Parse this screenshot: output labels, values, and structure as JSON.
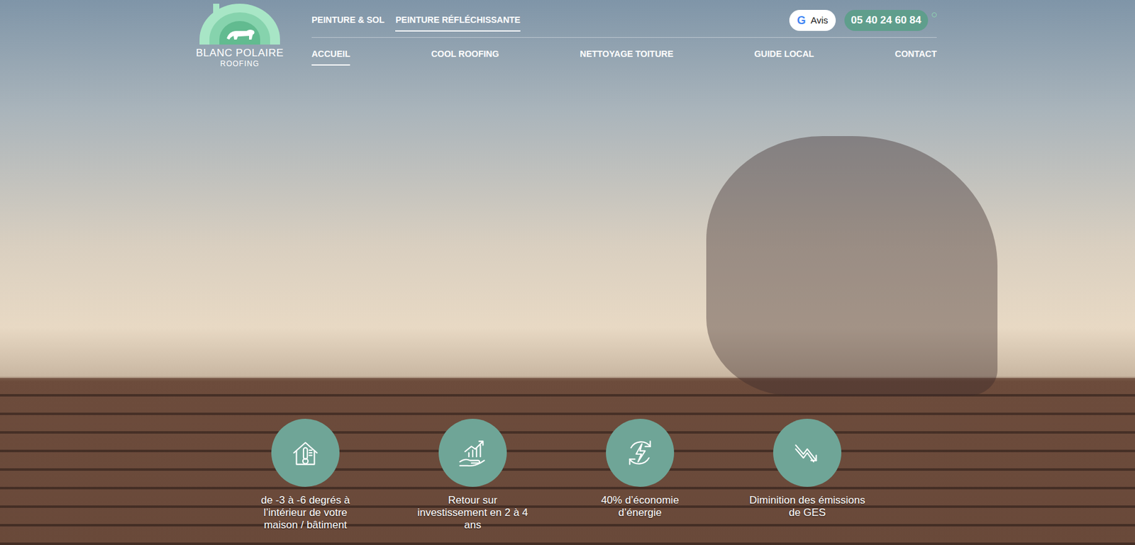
{
  "logo": {
    "name": "BLANC POLAIRE",
    "sub": "ROOFING"
  },
  "top_nav": [
    {
      "label": "PEINTURE & SOL",
      "selected": false
    },
    {
      "label": "PEINTURE RÉFLÉCHISSANTE",
      "selected": true
    }
  ],
  "review_button": {
    "icon": "G",
    "label": "Avis"
  },
  "phone": "05 40 24 60 84",
  "main_nav": [
    {
      "label": "ACCUEIL",
      "selected": true
    },
    {
      "label": "COOL ROOFING",
      "selected": false
    },
    {
      "label": "NETTOYAGE TOITURE",
      "selected": false
    },
    {
      "label": "GUIDE LOCAL",
      "selected": false
    },
    {
      "label": "CONTACT",
      "selected": false
    }
  ],
  "features": [
    {
      "label": "de -3 à -6 degrés à l’intérieur de votre maison / bâtiment",
      "kind": "thermo"
    },
    {
      "label": "Retour sur investissement en 2 à 4 ans",
      "kind": "growth"
    },
    {
      "label": "40% d’économie d’énergie",
      "kind": "energy"
    },
    {
      "label": "Diminition des émissions de GES",
      "kind": "decline"
    }
  ]
}
